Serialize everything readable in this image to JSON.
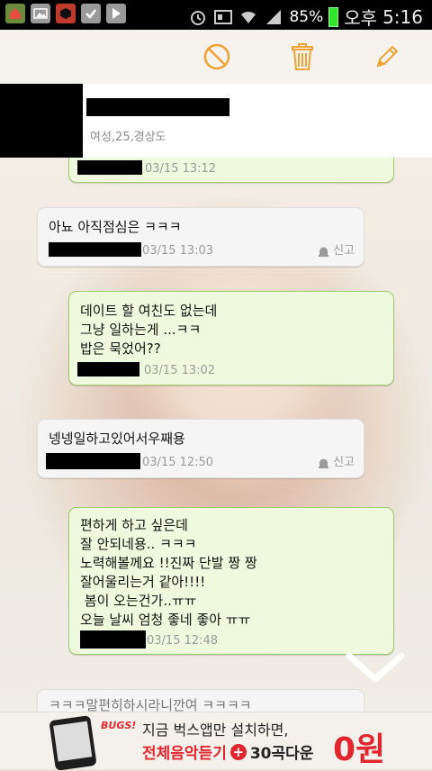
{
  "status_bar": {
    "battery": "85%",
    "ampm": "오후",
    "time": "5:16"
  },
  "profile": {
    "info": "여성,25,경상도"
  },
  "messages": [
    {
      "type": "sent",
      "text": "",
      "timestamp": "03/15 13:12"
    },
    {
      "type": "received",
      "text": "아뇨 아직점심은 ㅋㅋㅋ",
      "timestamp": "03/15 13:03",
      "report": "신고"
    },
    {
      "type": "sent",
      "text": "데이트 할 여친도 없는데\n그냥 일하는게 ...ㅋㅋ\n밥은 묵었어??",
      "timestamp": "03/15 13:02"
    },
    {
      "type": "received",
      "text": "넹넹일하고있어서우째용",
      "timestamp": "03/15 12:50",
      "report": "신고"
    },
    {
      "type": "sent",
      "text": "편하게 하고 싶은데\n잘 안되네용.. ㅋㅋㅋ\n노력해볼께요 !!진짜 단발 짱 짱\n잘어울리는거 같아!!!!\n 봄이 오는건가..ㅠㅠ\n오늘 날씨 엄청 좋네 좋아 ㅠㅠ",
      "timestamp": "03/15 12:48"
    },
    {
      "type": "received",
      "text": "ㅋㅋㅋ말편히하시라니깐여 ㅋㅋㅋㅋ",
      "timestamp": ""
    }
  ],
  "ad": {
    "brand": "BUGS!",
    "line1": "지금 벅스앱만 설치하면,",
    "line2a": "전체음악듣기",
    "plus": "+",
    "line2b": "30곡다운",
    "price": "0원"
  },
  "colors": {
    "sent_bubble": "#eef9dd",
    "sent_border": "#9fca70",
    "received_bubble": "#f5f5f5",
    "accent_orange": "#f0a233",
    "ad_red": "#e3262d"
  },
  "icons": {
    "block": "block-icon",
    "delete": "trash-icon",
    "edit": "pencil-icon",
    "report": "siren-icon"
  }
}
